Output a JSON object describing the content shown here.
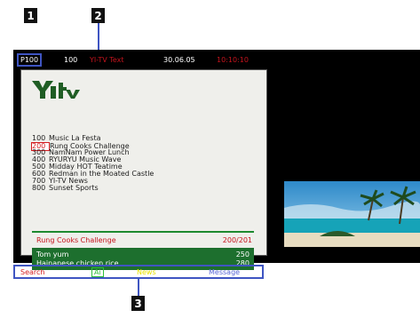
{
  "callouts": [
    "1",
    "2",
    "3"
  ],
  "header": {
    "page": "P100",
    "number": "100",
    "title": "YI-TV Text",
    "date": "30.06.05",
    "time": "10:10:10"
  },
  "logo": "YI-TV",
  "programs": [
    {
      "num": "100",
      "title": "Music La Festa",
      "selected": false
    },
    {
      "num": "200",
      "title": "Rung Cooks Challenge",
      "selected": true
    },
    {
      "num": "300",
      "title": "NamNam Power Lunch",
      "selected": false
    },
    {
      "num": "400",
      "title": "RYURYU Music Wave",
      "selected": false
    },
    {
      "num": "500",
      "title": "Midday HOT Teatime",
      "selected": false
    },
    {
      "num": "600",
      "title": "Redman in the Moated Castle",
      "selected": false
    },
    {
      "num": "700",
      "title": "YI-TV News",
      "selected": false
    },
    {
      "num": "800",
      "title": "Sunset Sports",
      "selected": false
    }
  ],
  "detail": {
    "title": "Rung Cooks Challenge",
    "page": "200/201",
    "items": [
      {
        "label": "Tom yum",
        "page": "250"
      },
      {
        "label": "Hainanese chicken rice",
        "page": "280"
      }
    ]
  },
  "nav": {
    "red": "Search",
    "green": "Ai",
    "yellow": "News",
    "blue": "Message"
  },
  "colors": {
    "background": "#000000",
    "panel": "#efefeb",
    "accent_red": "#c5141d",
    "green_box": "#1d6f2e",
    "callout_blue": "#3f55c2",
    "yellow": "#e6e100"
  }
}
